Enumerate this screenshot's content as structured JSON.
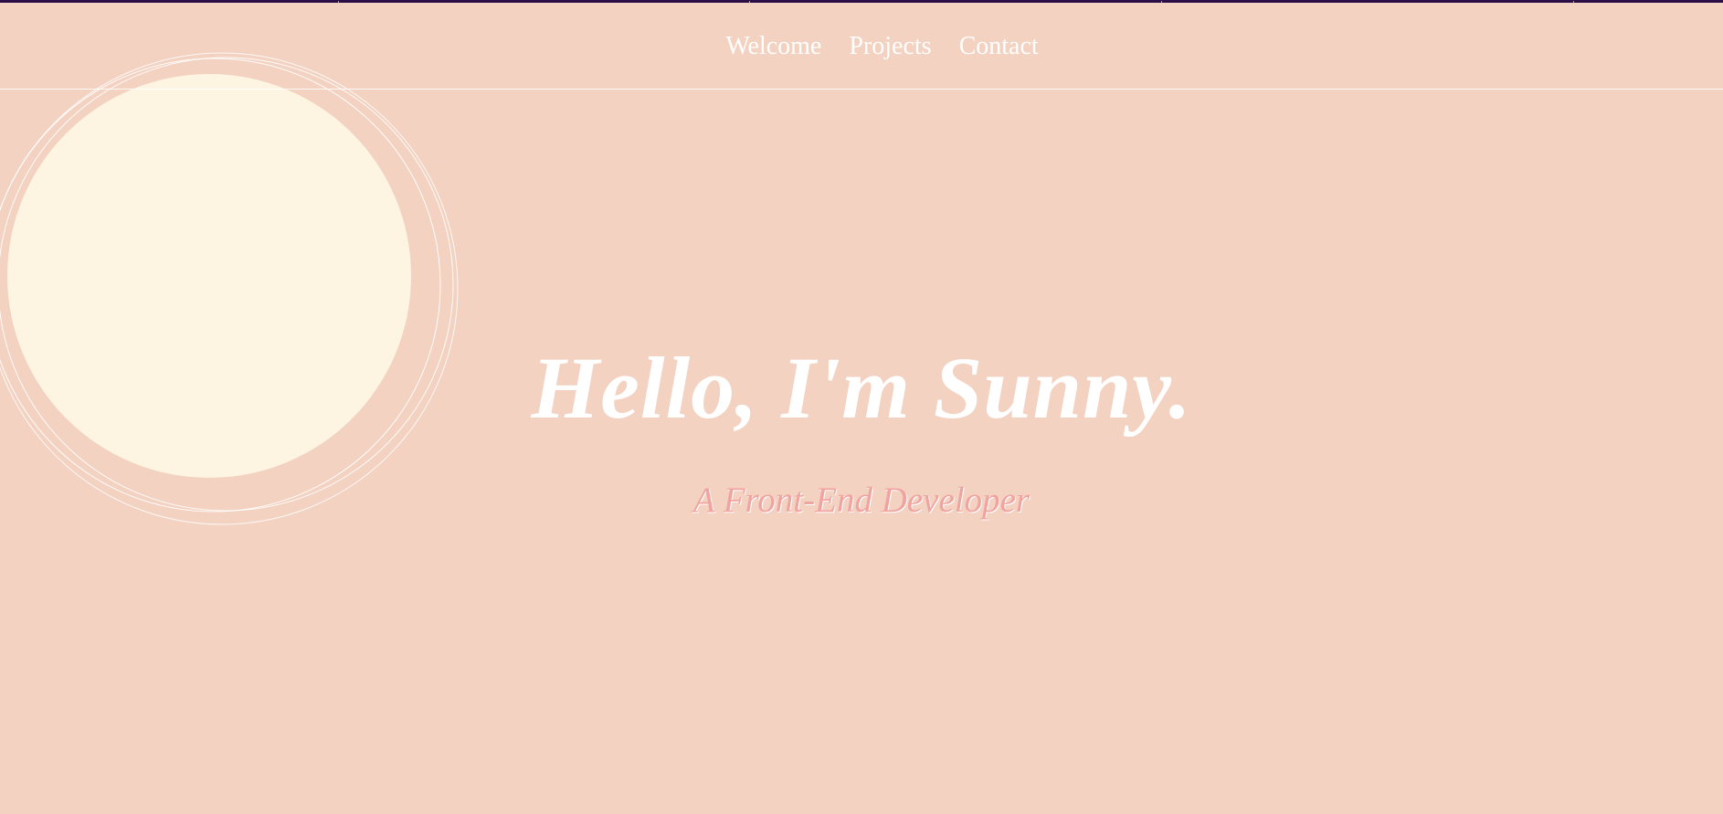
{
  "nav": {
    "items": [
      {
        "label": "Welcome"
      },
      {
        "label": "Projects"
      },
      {
        "label": "Contact"
      }
    ]
  },
  "hero": {
    "title": "Hello, I'm Sunny.",
    "subtitle": "A Front-End Developer"
  },
  "colors": {
    "background": "#f3d2c1",
    "sun": "#fdf5e2",
    "accent": "#f1a3a0",
    "top_strip": "#2b0d47",
    "text": "#ffffff"
  }
}
